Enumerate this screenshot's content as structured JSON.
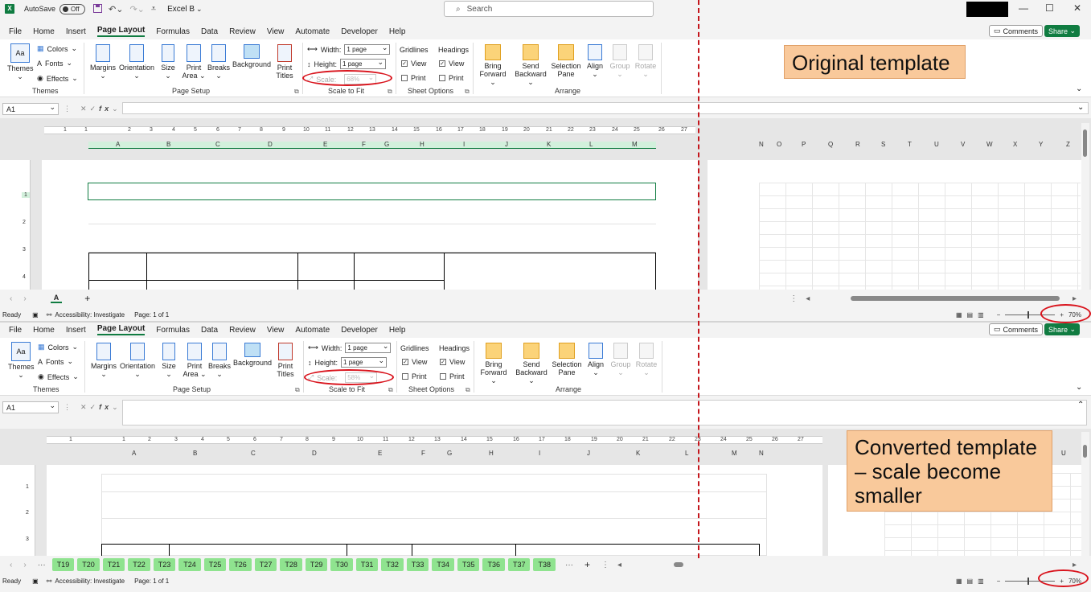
{
  "title_bar": {
    "app_icon": "X",
    "autosave_label": "AutoSave",
    "autosave_state": "Off",
    "file_name": "Excel B",
    "search_placeholder": "Search",
    "window_controls": [
      "—",
      "☐",
      "✕"
    ]
  },
  "menu": {
    "tabs": [
      "File",
      "Home",
      "Insert",
      "Page Layout",
      "Formulas",
      "Data",
      "Review",
      "View",
      "Automate",
      "Developer",
      "Help"
    ],
    "active_tab": "Page Layout",
    "comments_label": "Comments",
    "share_label": "Share"
  },
  "ribbon": {
    "themes": {
      "themes_label": "Themes",
      "colors_label": "Colors",
      "fonts_label": "Fonts",
      "effects_label": "Effects",
      "group_name": "Themes"
    },
    "page_setup": {
      "margins": "Margins",
      "orientation": "Orientation",
      "size": "Size",
      "print_area": "Print Area",
      "breaks": "Breaks",
      "background": "Background",
      "print_titles": "Print Titles",
      "group_name": "Page Setup"
    },
    "scale_to_fit": {
      "width_label": "Width:",
      "width_value": "1 page",
      "height_label": "Height:",
      "height_value": "1 page",
      "scale_label": "Scale:",
      "group_name": "Scale to Fit"
    },
    "sheet_options": {
      "gridlines_label": "Gridlines",
      "headings_label": "Headings",
      "view_label": "View",
      "print_label": "Print",
      "group_name": "Sheet Options"
    },
    "arrange": {
      "bring_forward": "Bring Forward",
      "send_backward": "Send Backward",
      "selection_pane": "Selection Pane",
      "align": "Align",
      "group": "Group",
      "rotate": "Rotate",
      "group_name": "Arrange"
    }
  },
  "top": {
    "scale_value": "68%",
    "name_box": "A1",
    "columns_left": [
      "A",
      "B",
      "C",
      "D",
      "E",
      "F",
      "G",
      "H",
      "I",
      "J",
      "K",
      "L",
      "M"
    ],
    "columns_right": [
      "N",
      "O",
      "P",
      "Q",
      "R",
      "S",
      "T",
      "U",
      "V",
      "W",
      "X",
      "Y",
      "Z"
    ],
    "ruler_ticks": [
      "1",
      "1",
      "2",
      "3",
      "4",
      "5",
      "6",
      "7",
      "8",
      "9",
      "10",
      "11",
      "12",
      "13",
      "14",
      "15",
      "16",
      "17",
      "18",
      "19",
      "20",
      "21",
      "22",
      "23",
      "24",
      "25",
      "26",
      "27"
    ],
    "rows": [
      "1",
      "2",
      "3",
      "4"
    ],
    "sheet_tab": "A",
    "status_ready": "Ready",
    "status_accessibility": "Accessibility: Investigate",
    "status_page": "Page: 1 of 1",
    "zoom": "70%",
    "callout": "Original template"
  },
  "bottom": {
    "scale_value": "58%",
    "name_box": "A1",
    "columns_left": [
      "A",
      "B",
      "C",
      "D",
      "E",
      "F",
      "G",
      "H",
      "I",
      "J",
      "K",
      "L",
      "M",
      "N"
    ],
    "columns_right": [
      "U"
    ],
    "ruler_ticks": [
      "1",
      "1",
      "2",
      "3",
      "4",
      "5",
      "6",
      "7",
      "8",
      "9",
      "10",
      "11",
      "12",
      "13",
      "14",
      "15",
      "16",
      "17",
      "18",
      "19",
      "20",
      "21",
      "22",
      "23",
      "24",
      "25",
      "26",
      "27"
    ],
    "rows": [
      "1",
      "2",
      "3"
    ],
    "sheet_tabs": [
      "T19",
      "T20",
      "T21",
      "T22",
      "T23",
      "T24",
      "T25",
      "T26",
      "T27",
      "T28",
      "T29",
      "T30",
      "T31",
      "T32",
      "T33",
      "T34",
      "T35",
      "T36",
      "T37",
      "T38"
    ],
    "status_ready": "Ready",
    "status_accessibility": "Accessibility: Investigate",
    "status_page": "Page: 1 of 1",
    "zoom": "70%",
    "callout": "Converted template – scale become smaller"
  },
  "colors": {
    "excel_green": "#107c41",
    "tab_green": "#8fe38f",
    "annotation_red": "#d9141d",
    "callout_fill": "#f9c99b"
  }
}
